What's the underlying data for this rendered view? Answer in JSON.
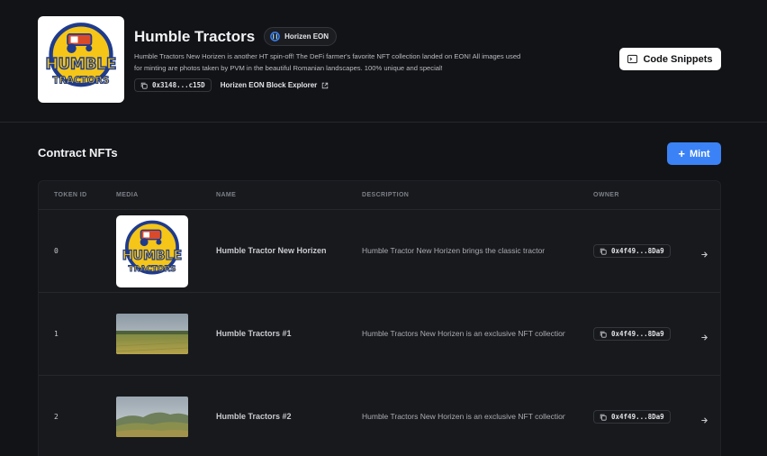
{
  "contract": {
    "title": "Humble Tractors",
    "chain_badge": "Horizen EON",
    "description": "Humble Tractors New Horizen is another HT spin-off! The DeFi farmer's favorite NFT collection landed on EON! All images used for minting are photos taken by PVM in the beautiful Romanian landscapes. 100% unique and special!",
    "address_short": "0x3148...c15D",
    "explorer_label": "Horizen EON Block Explorer",
    "code_snippets_label": "Code Snippets",
    "logo_text_top": "HUMBLE",
    "logo_text_bottom": "TRACTORS"
  },
  "nfts": {
    "section_title": "Contract NFTs",
    "mint_label": "Mint",
    "columns": [
      "TOKEN ID",
      "MEDIA",
      "NAME",
      "DESCRIPTION",
      "OWNER"
    ],
    "rows": [
      {
        "token_id": "0",
        "name": "Humble Tractor New Horizen",
        "description": "Humble Tractor New Horizen brings the classic tractor",
        "owner": "0x4f49...8Da9"
      },
      {
        "token_id": "1",
        "name": "Humble Tractors #1",
        "description": "Humble Tractors New Horizen is an exclusive NFT collection",
        "owner": "0x4f49...8Da9"
      },
      {
        "token_id": "2",
        "name": "Humble Tractors #2",
        "description": "Humble Tractors New Horizen is an exclusive NFT collection",
        "owner": "0x4f49...8Da9"
      }
    ]
  },
  "icons": {
    "chain": "horizen-logo-icon",
    "copy": "copy-icon",
    "external": "external-link-icon",
    "terminal": "terminal-icon",
    "plus": "plus-icon",
    "row_arrow": "arrow-right-icon"
  },
  "colors": {
    "background": "#121316",
    "table_bg": "#18191d",
    "accent": "#3b82f6",
    "logo_yellow": "#f5c518",
    "logo_blue": "#1f3b8c",
    "logo_red": "#d94a2b"
  }
}
